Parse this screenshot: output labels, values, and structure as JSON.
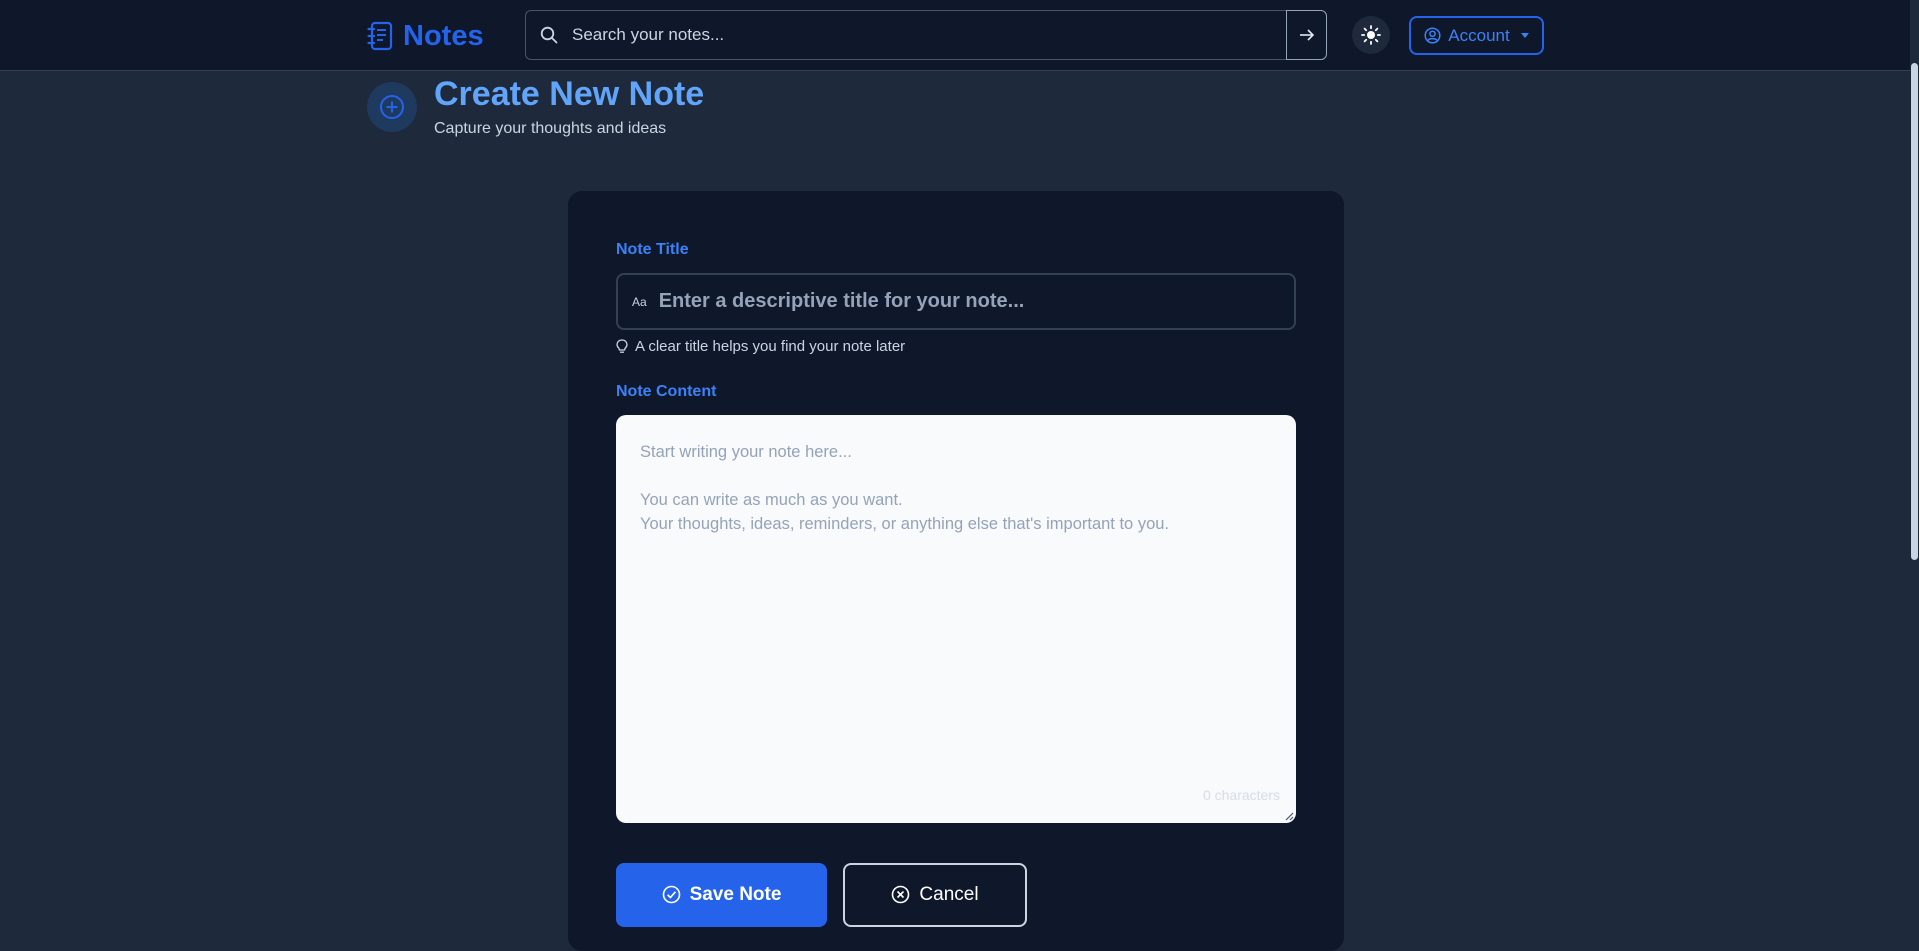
{
  "navbar": {
    "brand": "Notes",
    "search": {
      "placeholder": "Search your notes..."
    },
    "account_label": "Account"
  },
  "page": {
    "title": "Create New Note",
    "subtitle": "Capture your thoughts and ideas"
  },
  "form": {
    "title_label": "Note Title",
    "title_icon_text": "Aa",
    "title_placeholder": "Enter a descriptive title for your note...",
    "title_hint": "A clear title helps you find your note later",
    "content_label": "Note Content",
    "content_placeholder": "Start writing your note here...\n\nYou can write as much as you want.\nYour thoughts, ideas, reminders, or anything else that's important to you.",
    "char_count": "0 characters",
    "save_label": "Save Note",
    "cancel_label": "Cancel"
  },
  "icons": {
    "brand": "notebook-icon",
    "search": "search-icon",
    "submit": "arrow-right-icon",
    "theme": "sun-icon",
    "account": "user-circle-icon",
    "page": "plus-circle-icon",
    "hint": "lightbulb-icon",
    "save": "check-circle-icon",
    "cancel": "x-circle-icon"
  },
  "colors": {
    "primary": "#2563eb",
    "accent": "#60a5fa",
    "background": "#1e293b",
    "surface": "#0f172a"
  }
}
